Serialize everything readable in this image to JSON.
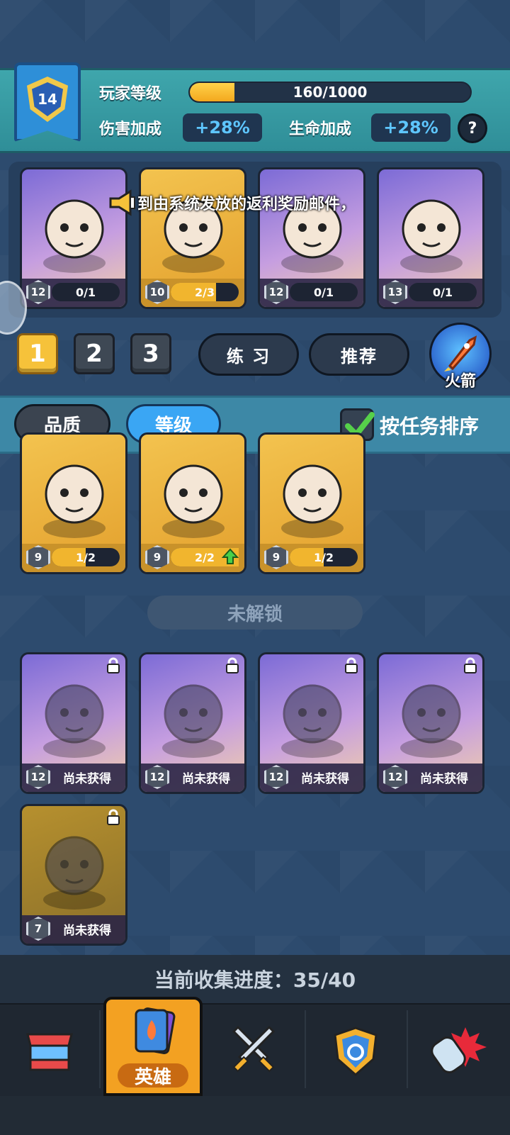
{
  "player": {
    "level": "14",
    "level_label": "玩家等级",
    "xp_text": "160/1000",
    "xp_progress": 0.16,
    "damage_label": "伤害加成",
    "damage_value": "+28%",
    "health_label": "生命加成",
    "health_value": "+28%",
    "help_label": "?"
  },
  "announcement": "到由系统发放的返利奖励邮件，",
  "team": [
    {
      "level": "12",
      "count": "0/1",
      "progress": 0.0,
      "frame": "purple",
      "icon": "panda-hero-icon"
    },
    {
      "level": "10",
      "count": "2/3",
      "progress": 0.67,
      "frame": "gold",
      "icon": "pink-hair-hero-icon"
    },
    {
      "level": "12",
      "count": "0/1",
      "progress": 0.0,
      "frame": "purple",
      "icon": "pumpkin-hero-icon"
    },
    {
      "level": "13",
      "count": "0/1",
      "progress": 0.0,
      "frame": "purple",
      "icon": "red-dragon-hero-icon"
    }
  ],
  "team_tabs": [
    "1",
    "2",
    "3"
  ],
  "active_team": "1",
  "practice_label": "练 习",
  "recommend_label": "推荐",
  "rocket_label": "火箭",
  "sort": {
    "quality_label": "品质",
    "level_label": "等级",
    "active": "level",
    "task_sort_label": "按任务排序",
    "task_sort_checked": true
  },
  "owned_heroes": [
    {
      "level": "9",
      "count": "1/2",
      "progress": 0.5,
      "icon": "knight-hero-icon",
      "upgrade": false
    },
    {
      "level": "9",
      "count": "2/2",
      "progress": 1.0,
      "icon": "wolf-hero-icon",
      "upgrade": true
    },
    {
      "level": "9",
      "count": "1/2",
      "progress": 0.5,
      "icon": "white-cat-hero-icon",
      "upgrade": false
    }
  ],
  "locked_section_label": "未解锁",
  "locked_heroes": [
    {
      "level": "12",
      "status": "尚未获得",
      "icon": "green-ghost-hero-icon"
    },
    {
      "level": "12",
      "status": "尚未获得",
      "icon": "monk-hero-icon"
    },
    {
      "level": "12",
      "status": "尚未获得",
      "icon": "samurai-hero-icon"
    },
    {
      "level": "12",
      "status": "尚未获得",
      "icon": "monkey-king-hero-icon"
    },
    {
      "level": "7",
      "status": "尚未获得",
      "icon": "shadow-golem-hero-icon"
    }
  ],
  "collection_progress": "当前收集进度：35/40",
  "nav": [
    {
      "label": "",
      "icon": "shop-icon"
    },
    {
      "label": "英雄",
      "icon": "hero-cards-icon"
    },
    {
      "label": "",
      "icon": "crossed-swords-icon"
    },
    {
      "label": "",
      "icon": "guild-shield-icon"
    },
    {
      "label": "",
      "icon": "gauntlet-icon"
    }
  ]
}
